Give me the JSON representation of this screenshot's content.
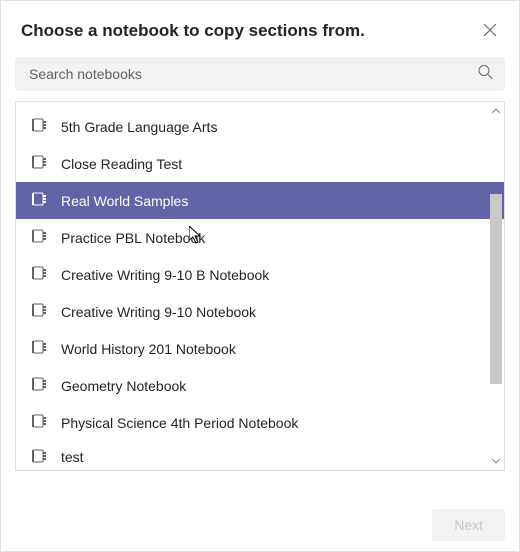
{
  "header": {
    "title": "Choose a notebook to copy sections from."
  },
  "search": {
    "placeholder": "Search notebooks"
  },
  "notebooks": [
    {
      "label": "5th Grade Language Arts",
      "selected": false
    },
    {
      "label": "Close Reading Test",
      "selected": false
    },
    {
      "label": "Real World Samples",
      "selected": true
    },
    {
      "label": "Practice PBL Notebook",
      "selected": false
    },
    {
      "label": "Creative Writing 9-10 B Notebook",
      "selected": false
    },
    {
      "label": "Creative Writing 9-10 Notebook",
      "selected": false
    },
    {
      "label": "World History 201 Notebook",
      "selected": false
    },
    {
      "label": "Geometry Notebook",
      "selected": false
    },
    {
      "label": "Physical Science 4th Period Notebook",
      "selected": false
    },
    {
      "label": "test",
      "selected": false,
      "cutoff": true
    }
  ],
  "footer": {
    "next_label": "Next"
  }
}
